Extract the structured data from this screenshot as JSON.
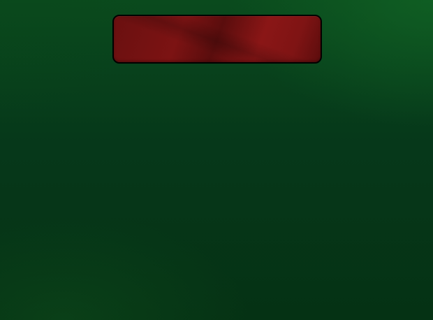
{
  "banner": {
    "label": "",
    "color": "#7c1313",
    "border_color": "#000000"
  },
  "table": {
    "felt_color": "#06381a"
  }
}
